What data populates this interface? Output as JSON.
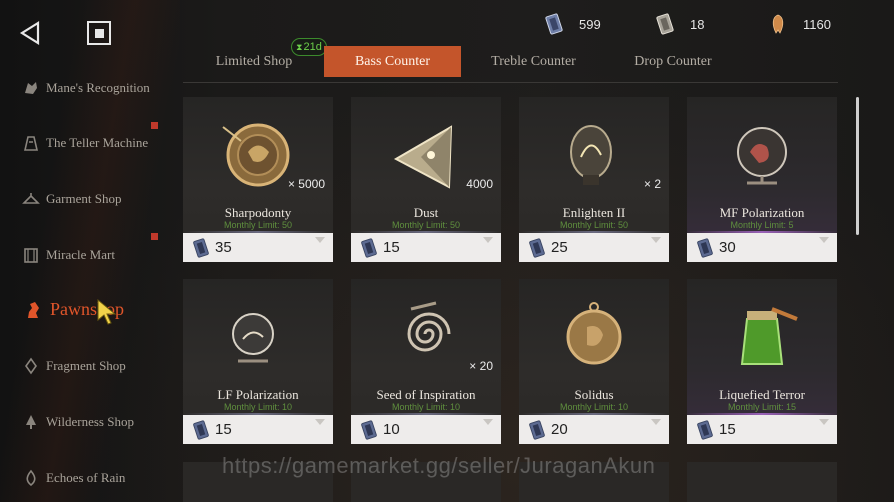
{
  "currencies": [
    {
      "icon": "crystal-ticket-icon",
      "value": "599"
    },
    {
      "icon": "silver-ticket-icon",
      "value": "18"
    },
    {
      "icon": "tooth-icon",
      "value": "1160"
    }
  ],
  "sidebar": {
    "items": [
      {
        "label": "Mane's Recognition",
        "icon": "lion-icon",
        "badge": false
      },
      {
        "label": "The Teller Machine",
        "icon": "machine-icon",
        "badge": true
      },
      {
        "label": "Garment Shop",
        "icon": "hanger-icon",
        "badge": false
      },
      {
        "label": "Miracle Mart",
        "icon": "mart-icon",
        "badge": true
      },
      {
        "label": "Pawnshop",
        "icon": "pawn-icon",
        "badge": false,
        "active": true
      },
      {
        "label": "Fragment Shop",
        "icon": "fragment-icon",
        "badge": false
      },
      {
        "label": "Wilderness Shop",
        "icon": "tree-icon",
        "badge": false
      },
      {
        "label": "Echoes of Rain",
        "icon": "rain-icon",
        "badge": false
      }
    ]
  },
  "tabs": [
    {
      "label": "Limited Shop",
      "active": false
    },
    {
      "label": "Bass Counter",
      "active": true
    },
    {
      "label": "Treble Counter",
      "active": false
    },
    {
      "label": "Drop Counter",
      "active": false
    }
  ],
  "timer": "21d",
  "items": [
    {
      "name": "Sharpodonty",
      "qty": "× 5000",
      "limit": "Monthly Limit: 50",
      "price": "35",
      "icon": "coin-icon"
    },
    {
      "name": "Dust",
      "qty": "4000",
      "limit": "Monthly Limit: 50",
      "price": "15",
      "icon": "dust-prism-icon"
    },
    {
      "name": "Enlighten II",
      "qty": "× 2",
      "limit": "Monthly Limit: 50",
      "price": "25",
      "icon": "bulb-icon"
    },
    {
      "name": "MF Polarization",
      "qty": "",
      "limit": "Monthly Limit: 5",
      "price": "30",
      "icon": "globe-icon"
    },
    {
      "name": "LF Polarization",
      "qty": "",
      "limit": "Monthly Limit: 10",
      "price": "15",
      "icon": "glass-orb-icon"
    },
    {
      "name": "Seed of Inspiration",
      "qty": "× 20",
      "limit": "Monthly Limit: 10",
      "price": "10",
      "icon": "spiral-icon"
    },
    {
      "name": "Solidus",
      "qty": "",
      "limit": "Monthly Limit: 10",
      "price": "20",
      "icon": "medal-icon"
    },
    {
      "name": "Liquefied Terror",
      "qty": "",
      "limit": "Monthly Limit: 15",
      "price": "15",
      "icon": "jar-icon"
    }
  ],
  "watermark": "https://gamemarket.gg/seller/JuraganAkun"
}
